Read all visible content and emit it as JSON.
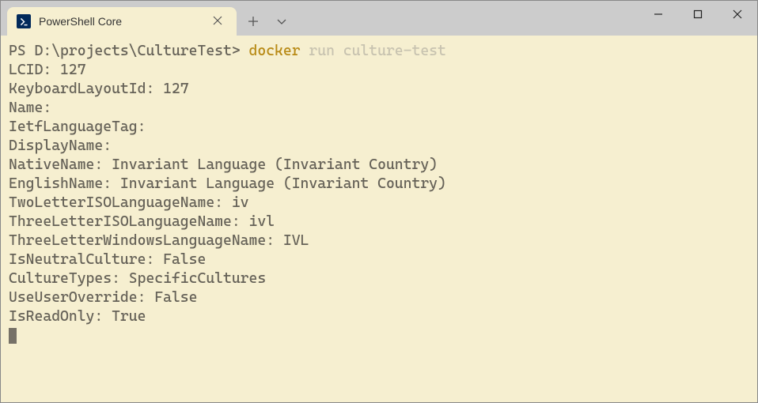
{
  "tab": {
    "title": "PowerShell Core"
  },
  "terminal": {
    "prompt": "PS D:\\projects\\CultureTest> ",
    "command_exe": "docker",
    "command_args": " run culture-test",
    "output_lines": [
      "LCID: 127",
      "KeyboardLayoutId: 127",
      "Name:",
      "IetfLanguageTag:",
      "DisplayName:",
      "NativeName: Invariant Language (Invariant Country)",
      "EnglishName: Invariant Language (Invariant Country)",
      "TwoLetterISOLanguageName: iv",
      "ThreeLetterISOLanguageName: ivl",
      "ThreeLetterWindowsLanguageName: IVL",
      "IsNeutralCulture: False",
      "CultureTypes: SpecificCultures",
      "UseUserOverride: False",
      "IsReadOnly: True"
    ]
  }
}
